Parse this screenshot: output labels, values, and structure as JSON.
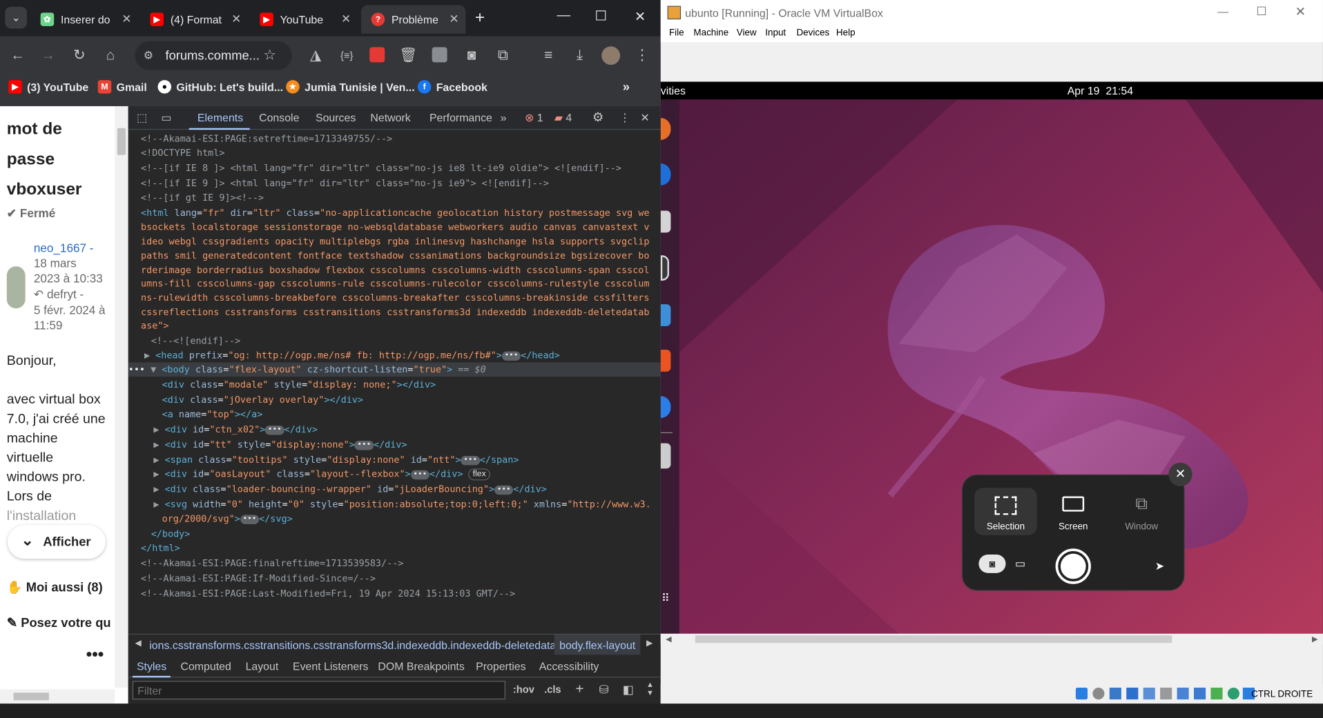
{
  "chrome": {
    "tabs": [
      {
        "title": "Inserer do",
        "color": "#6dd58c"
      },
      {
        "title": "(4) Format",
        "color": "#ff0000"
      },
      {
        "title": "YouTube",
        "color": "#ff0000"
      },
      {
        "title": "Problème",
        "color": "#e53935"
      }
    ],
    "address": "forums.comme...",
    "bookmarks": [
      {
        "label": "(3) YouTube",
        "color": "#ff0000"
      },
      {
        "label": "Gmail",
        "color": "#ea4335"
      },
      {
        "label": "GitHub: Let's build...",
        "color": "#ffffff"
      },
      {
        "label": "Jumia Tunisie | Ven...",
        "color": "#f68b1e"
      },
      {
        "label": "Facebook",
        "color": "#1877f2"
      }
    ]
  },
  "page": {
    "title_lines": [
      "mot de",
      "passe",
      "vboxuser"
    ],
    "status": "Fermé",
    "author": "neo_1667 -",
    "date1": "18 mars",
    "time1": "2023 à 10:33",
    "replier": "defryt -",
    "date2": "5 févr. 2024 à",
    "time2": "11:59",
    "body_lines": [
      "Bonjour,",
      "",
      "avec virtual box",
      "7.0, j'ai créé une",
      "machine",
      "virtuelle",
      "windows pro.",
      "Lors de",
      "l'installation"
    ],
    "show_button": "Afficher",
    "me_too": "Moi aussi (8)",
    "ask": "Posez votre qu"
  },
  "devtools": {
    "tabs": [
      "Elements",
      "Console",
      "Sources",
      "Network",
      "Performance"
    ],
    "error_count": "1",
    "warning_count": "4",
    "lines": [
      "<!--Akamai-ESI:PAGE:setreftime=1713349755/-->",
      "<!DOCTYPE html>",
      "<!--[if IE 8 ]> <html lang=\"fr\" dir=\"ltr\" class=\"no-js ie8 lt-ie9 oldie\"> <![endif]-->",
      "<!--[if IE 9 ]> <html lang=\"fr\" dir=\"ltr\" class=\"no-js ie9\"> <![endif]-->",
      "<!--[if gt IE 9]><!-->",
      "no-applicationcache geolocation history postmessage svg we",
      "bsockets localstorage sessionstorage no-websqldatabase webworkers audio canvas canvastext v",
      "ideo webgl cssgradients opacity multiplebgs rgba inlinesvg hashchange hsla supports svgclip",
      "paths smil generatedcontent fontface textshadow cssanimations backgroundsize bgsizecover bo",
      "rderimage borderradius boxshadow flexbox csscolumns csscolumns-width csscolumns-span csscol",
      "umns-fill csscolumns-gap csscolumns-rule csscolumns-rulecolor csscolumns-rulestyle csscolum",
      "ns-rulewidth csscolumns-breakbefore csscolumns-breakafter csscolumns-breakinside cssfilters",
      "cssreflections csstransforms csstransitions csstransforms3d indexeddb indexeddb-deletedatab",
      "ase\">",
      "<!--<![endif]-->",
      "<!--Akamai-ESI:PAGE:finalreftime=1713539583/-->",
      "<!--Akamai-ESI:PAGE:If-Modified-Since=/-->",
      "<!--Akamai-ESI:PAGE:Last-Modified=Fri, 19 Apr 2024 15:13:03 GMT/-->"
    ],
    "selected_eq": "== $0",
    "breadcrumb_1": "ions.csstransforms.csstransitions.csstransforms3d.indexeddb.indexeddb-deletedatabase",
    "breadcrumb_2": "body.flex-layout",
    "subtabs": [
      "Styles",
      "Computed",
      "Layout",
      "Event Listeners",
      "DOM Breakpoints",
      "Properties",
      "Accessibility"
    ],
    "filter_placeholder": "Filter",
    "hov": ":hov",
    "cls": ".cls",
    "flex_badge": "flex"
  },
  "vbox": {
    "title": "ubunto [Running] - Oracle VM VirtualBox",
    "menu": [
      "File",
      "Machine",
      "View",
      "Input",
      "Devices",
      "Help"
    ],
    "activities": "vities",
    "clock": "Apr 19  21:54",
    "modes": [
      "Selection",
      "Screen",
      "Window"
    ],
    "host_key": "CTRL DROITE"
  }
}
